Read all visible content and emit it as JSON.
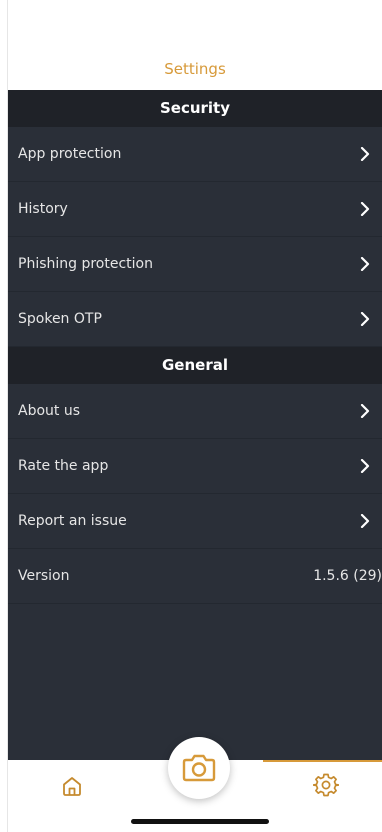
{
  "header": {
    "title": "Settings"
  },
  "sections": {
    "security": {
      "title": "Security",
      "items": [
        "App protection",
        "History",
        "Phishing protection",
        "Spoken OTP"
      ]
    },
    "general": {
      "title": "General",
      "items": [
        "About us",
        "Rate the app",
        "Report an issue"
      ],
      "version_label": "Version",
      "version_value": "1.5.6 (29)"
    }
  },
  "tabbar": {
    "active_tab": "settings",
    "icons": {
      "home": "home-icon",
      "camera": "camera-icon",
      "settings": "gear-icon"
    }
  },
  "colors": {
    "accent": "#d79a3a",
    "background": "#2a2f38",
    "section_header": "#1f2228"
  }
}
